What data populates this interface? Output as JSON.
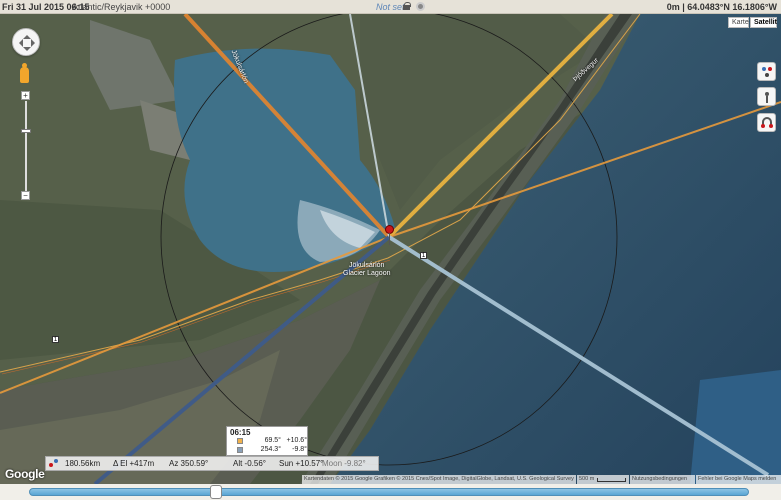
{
  "topbar": {
    "datetime": "Fri 31 Jul 2015 06:15",
    "timezone": "Atlantic/Reykjavik +0000",
    "location_status": "Not set",
    "coords": "0m | 64.0483°N 16.1806°W"
  },
  "map": {
    "type_buttons": {
      "karte": "Karte",
      "satellit": "Satellit"
    },
    "active_type": "Satellit",
    "labels": {
      "lagoon_line1": "Jökulsárlón",
      "lagoon_line2": "Glacier Lagoon",
      "river": "Jökulsárlón",
      "road": "Þjóðvegur"
    },
    "road_number": "1",
    "road_number_west": "1",
    "zoom_in": "+",
    "zoom_out": "−",
    "google": "Google",
    "attribution": "Kartendaten © 2015 Google Grafiken © 2015 Cnes/Spot Image, DigitalGlobe, Landsat, U.S. Geological Survey",
    "scale": "500 m",
    "terms": "Nutzungsbedingungen",
    "report": "Fehler bei Google Maps melden"
  },
  "popup": {
    "time": "06:15",
    "rows": [
      {
        "az": "69.5°",
        "el": "+10.6°",
        "color": "#f2b24b"
      },
      {
        "az": "254.3°",
        "el": "-9.8°",
        "color": "#8aa0b8"
      }
    ]
  },
  "infobar": {
    "distance": "180.56km",
    "delta_el": "Δ El +417m",
    "azimuth": "Az 350.59°",
    "altitude": "Alt -0.56°",
    "sun": "Sun +10.57°",
    "moon": "Moon -9.82°"
  },
  "slider": {
    "position": 0.26
  },
  "colors": {
    "sunrise_line": "#e5862f",
    "sun_line": "#f0b740",
    "moon_line": "#a8c3d4",
    "moonset_line": "#3e5b8a",
    "azimuth_line": "#c9d6dc",
    "slider": "#5aa6d4"
  }
}
